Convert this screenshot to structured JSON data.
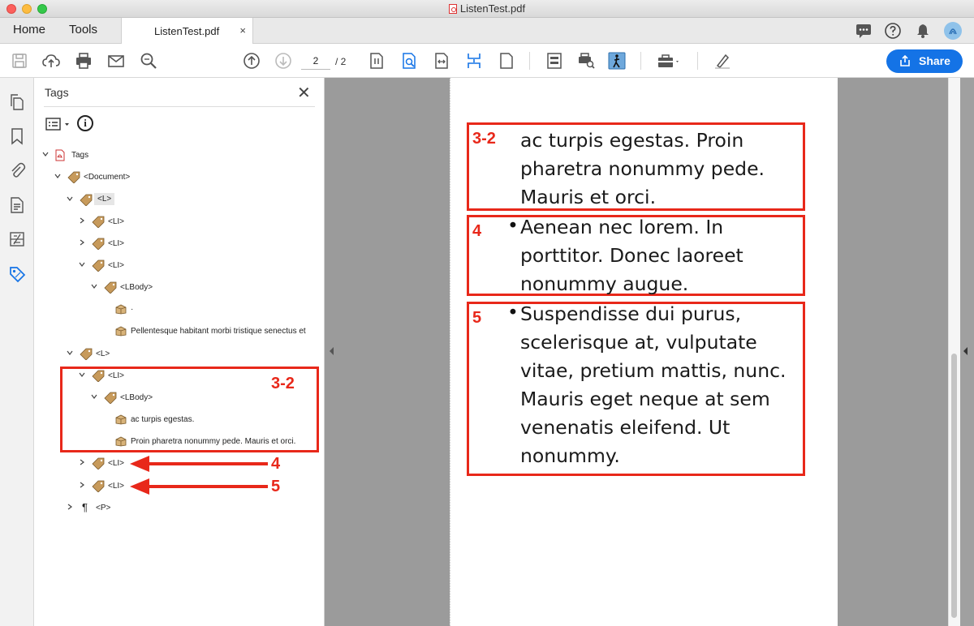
{
  "window": {
    "title": "ListenTest.pdf"
  },
  "tabs": {
    "home": "Home",
    "tools": "Tools",
    "document": "ListenTest.pdf",
    "close": "×"
  },
  "toolbar": {
    "page_current": "2",
    "page_total": "/ 2",
    "share_label": "Share"
  },
  "tags_panel": {
    "title": "Tags",
    "close": "✕",
    "info": "i",
    "tree": [
      {
        "label": "Tags",
        "kind": "root"
      },
      {
        "label": "<Document>",
        "kind": "tag"
      },
      {
        "label": "<L>",
        "kind": "tag",
        "selected": true
      },
      {
        "label": "<LI>",
        "kind": "tag"
      },
      {
        "label": "<LI>",
        "kind": "tag"
      },
      {
        "label": "<LI>",
        "kind": "tag"
      },
      {
        "label": "<LBody>",
        "kind": "tag"
      },
      {
        "label": "·",
        "kind": "content"
      },
      {
        "label": "Pellentesque habitant morbi tristique senectus et",
        "kind": "content"
      },
      {
        "label": "<L>",
        "kind": "tag"
      },
      {
        "label": "<LI>",
        "kind": "tag"
      },
      {
        "label": "<LBody>",
        "kind": "tag"
      },
      {
        "label": "ac turpis egestas.",
        "kind": "content"
      },
      {
        "label": "Proin pharetra nonummy pede. Mauris et orci.",
        "kind": "content"
      },
      {
        "label": "<LI>",
        "kind": "tag"
      },
      {
        "label": "<LI>",
        "kind": "tag"
      },
      {
        "label": "<P>",
        "kind": "paragraph"
      }
    ]
  },
  "annotations": {
    "a32": "3-2",
    "a4": "4",
    "a5": "5",
    "color": "#e8281a"
  },
  "document": {
    "item32": [
      "ac turpis egestas. Proin",
      "pharetra nonummy pede.",
      "Mauris et orci."
    ],
    "item4": [
      "Aenean nec lorem. In",
      "porttitor. Donec laoreet",
      "nonummy augue."
    ],
    "item5": [
      "Suspendisse dui purus,",
      "scelerisque at, vulputate",
      "vitae, pretium mattis, nunc.",
      "Mauris eget neque at sem",
      "venenatis eleifend. Ut",
      "nonummy."
    ],
    "bullet": "•"
  },
  "colors": {
    "accent": "#1473e6",
    "annotation": "#e8281a"
  }
}
